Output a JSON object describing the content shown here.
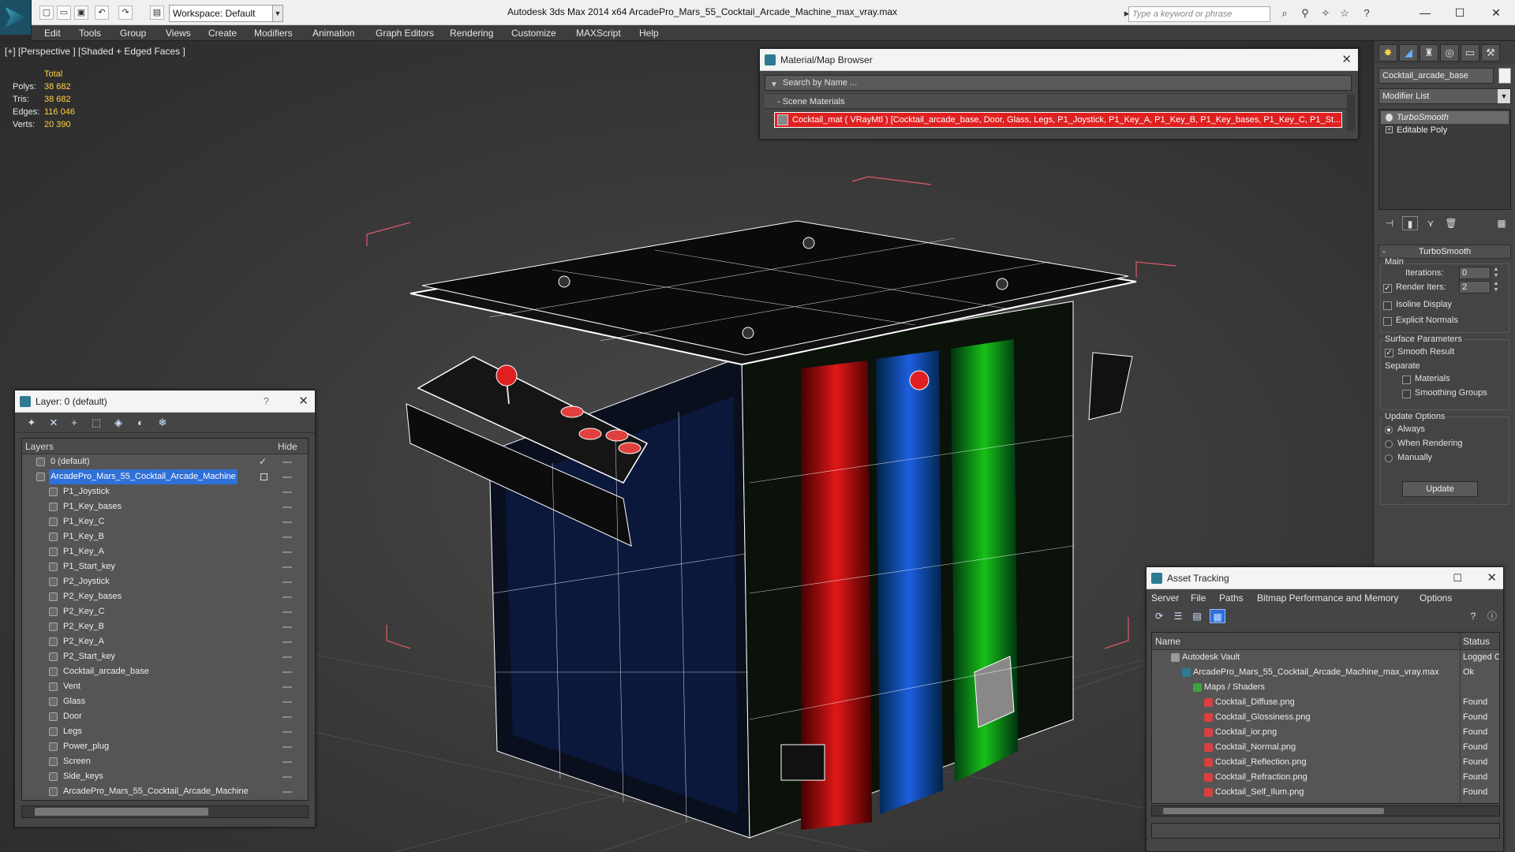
{
  "app": {
    "title": "Autodesk 3ds Max  2014 x64      ArcadePro_Mars_55_Cocktail_Arcade_Machine_max_vray.max",
    "workspace": "Workspace: Default",
    "search_placeholder": "Type a keyword or phrase"
  },
  "menu": [
    "Edit",
    "Tools",
    "Group",
    "Views",
    "Create",
    "Modifiers",
    "Animation",
    "Graph Editors",
    "Rendering",
    "Customize",
    "MAXScript",
    "Help"
  ],
  "viewport": {
    "label": "[+] [Perspective ] [Shaded + Edged Faces ]",
    "stats": {
      "header": "Total",
      "rows": [
        {
          "k": "Polys:",
          "v": "38 682"
        },
        {
          "k": "Tris:",
          "v": "38 682"
        },
        {
          "k": "Edges:",
          "v": "116 046"
        },
        {
          "k": "Verts:",
          "v": "20 390"
        }
      ]
    }
  },
  "layer_window": {
    "title": "Layer: 0 (default)",
    "help": "?",
    "close": "✕",
    "col_layers": "Layers",
    "col_hide": "Hide",
    "rows": [
      {
        "name": "0 (default)",
        "indent": 0,
        "check": true
      },
      {
        "name": "ArcadePro_Mars_55_Cocktail_Arcade_Machine",
        "indent": 0,
        "selected": true
      },
      {
        "name": "P1_Joystick",
        "indent": 1
      },
      {
        "name": "P1_Key_bases",
        "indent": 1
      },
      {
        "name": "P1_Key_C",
        "indent": 1
      },
      {
        "name": "P1_Key_B",
        "indent": 1
      },
      {
        "name": "P1_Key_A",
        "indent": 1
      },
      {
        "name": "P1_Start_key",
        "indent": 1
      },
      {
        "name": "P2_Joystick",
        "indent": 1
      },
      {
        "name": "P2_Key_bases",
        "indent": 1
      },
      {
        "name": "P2_Key_C",
        "indent": 1
      },
      {
        "name": "P2_Key_B",
        "indent": 1
      },
      {
        "name": "P2_Key_A",
        "indent": 1
      },
      {
        "name": "P2_Start_key",
        "indent": 1
      },
      {
        "name": "Cocktail_arcade_base",
        "indent": 1
      },
      {
        "name": "Vent",
        "indent": 1
      },
      {
        "name": "Glass",
        "indent": 1
      },
      {
        "name": "Door",
        "indent": 1
      },
      {
        "name": "Legs",
        "indent": 1
      },
      {
        "name": "Power_plug",
        "indent": 1
      },
      {
        "name": "Screen",
        "indent": 1
      },
      {
        "name": "Side_keys",
        "indent": 1
      },
      {
        "name": "ArcadePro_Mars_55_Cocktail_Arcade_Machine",
        "indent": 1
      }
    ]
  },
  "material_browser": {
    "title": "Material/Map Browser",
    "close": "✕",
    "search": "Search by Name ...",
    "section": "- Scene Materials",
    "entry": "Cocktail_mat  ( VRayMtl ) [Cocktail_arcade_base, Door, Glass, Legs, P1_Joystick, P1_Key_A, P1_Key_B, P1_Key_bases, P1_Key_C, P1_St..."
  },
  "command_panel": {
    "object_name": "Cocktail_arcade_base",
    "modifier_list": "Modifier List",
    "stack": [
      {
        "name": "TurboSmooth",
        "selected": true
      },
      {
        "name": "Editable Poly",
        "selected": false
      }
    ],
    "rollout": {
      "title": "TurboSmooth",
      "main": "Main",
      "iterations_label": "Iterations:",
      "iterations": "0",
      "render_iters_label": "Render Iters:",
      "render_iters": "2",
      "isoline": "Isoline Display",
      "explicit": "Explicit Normals",
      "surface": "Surface Parameters",
      "smooth_result": "Smooth Result",
      "separate": "Separate",
      "materials": "Materials",
      "smoothing_groups": "Smoothing Groups",
      "update_options": "Update Options",
      "always": "Always",
      "when_rendering": "When Rendering",
      "manually": "Manually",
      "update": "Update"
    }
  },
  "asset_tracking": {
    "title": "Asset Tracking",
    "close": "✕",
    "menu": [
      "Server",
      "File",
      "Paths",
      "Bitmap Performance and Memory",
      "Options"
    ],
    "col_name": "Name",
    "col_status": "Status",
    "rows": [
      {
        "name": "Autodesk Vault",
        "status": "Logged O",
        "indent": 1,
        "icon": "vault"
      },
      {
        "name": "ArcadePro_Mars_55_Cocktail_Arcade_Machine_max_vray.max",
        "status": "Ok",
        "indent": 2,
        "icon": "max"
      },
      {
        "name": "Maps / Shaders",
        "status": "",
        "indent": 3,
        "icon": "folder"
      },
      {
        "name": "Cocktail_Diffuse.png",
        "status": "Found",
        "indent": 4,
        "icon": "png"
      },
      {
        "name": "Cocktail_Glossiness.png",
        "status": "Found",
        "indent": 4,
        "icon": "png"
      },
      {
        "name": "Cocktail_ior.png",
        "status": "Found",
        "indent": 4,
        "icon": "png"
      },
      {
        "name": "Cocktail_Normal.png",
        "status": "Found",
        "indent": 4,
        "icon": "png"
      },
      {
        "name": "Cocktail_Reflection.png",
        "status": "Found",
        "indent": 4,
        "icon": "png"
      },
      {
        "name": "Cocktail_Refraction.png",
        "status": "Found",
        "indent": 4,
        "icon": "png"
      },
      {
        "name": "Cocktail_Self_Ilum.png",
        "status": "Found",
        "indent": 4,
        "icon": "png"
      }
    ]
  },
  "colors": {
    "stat_value": "#ffd23f",
    "selection": "#2f6fd8",
    "material_highlight": "#e02020",
    "wire": "#ffffff",
    "bbox": "#e05a6a"
  }
}
